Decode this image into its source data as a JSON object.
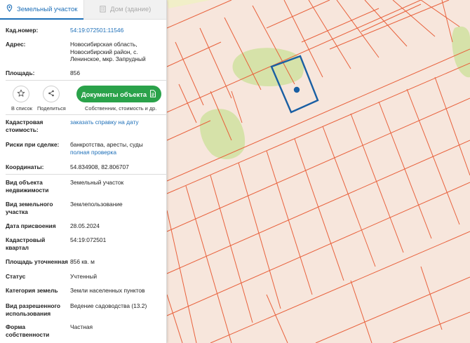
{
  "tabs": {
    "land": "Земельный участок",
    "building": "Дом (здание)"
  },
  "fields": {
    "cad_number": {
      "label": "Кад.номер:",
      "value": "54:19:072501:11546"
    },
    "address": {
      "label": "Адрес:",
      "lines": [
        "Новосибирская область,",
        "Новосибирский район, с.",
        "Ленинское, мкр. Запрудный"
      ]
    },
    "area": {
      "label": "Площадь:",
      "value": "856"
    }
  },
  "actions": {
    "favorite": "В список",
    "share": "Поделиться",
    "documents_button": "Документы объекта",
    "documents_sub": "Собственник, стоимость и др."
  },
  "cadastral_value": {
    "label_lines": [
      "Кадастровая",
      "стоимость:"
    ],
    "link": "заказать справку на дату"
  },
  "risks": {
    "label": "Риски при сделке:",
    "value": "банкротства, аресты, суды",
    "link": "полная проверка"
  },
  "coordinates": {
    "label": "Координаты:",
    "value": "54.834908, 82.806707"
  },
  "details": {
    "object_type": {
      "label_lines": [
        "Вид объекта",
        "недвижимости"
      ],
      "value": "Земельный участок"
    },
    "land_type": {
      "label_lines": [
        "Вид земельного",
        "участка"
      ],
      "value": "Землепользование"
    },
    "assigned_date": {
      "label": "Дата присвоения",
      "value": "28.05.2024"
    },
    "quarter": {
      "label_lines": [
        "Кадастровый",
        "квартал"
      ],
      "value": "54:19:072501"
    },
    "area_precise": {
      "label": "Площадь уточненная",
      "value": "856 кв. м"
    },
    "status": {
      "label": "Статус",
      "value": "Учтенный"
    },
    "category": {
      "label": "Категория земель",
      "value": "Земли населенных пунктов"
    },
    "permitted_use": {
      "label_lines": [
        "Вид разрешенного",
        "использования"
      ],
      "value": "Ведение садоводства (13.2)"
    },
    "ownership": {
      "label_lines": [
        "Форма",
        "собственности"
      ],
      "value": "Частная"
    }
  },
  "colors": {
    "accent": "#1d6fb8",
    "button": "#2aa24a",
    "map_background": "#f7e6dc",
    "parcel_lines": "#e8613c",
    "green_areas": "#d7e3ab",
    "selected_parcel": "#1a5fa3"
  },
  "icons": {
    "land_tab": "map-marker-icon",
    "building_tab": "building-icon",
    "favorite": "star-icon",
    "share": "share-icon",
    "documents": "document-icon"
  }
}
